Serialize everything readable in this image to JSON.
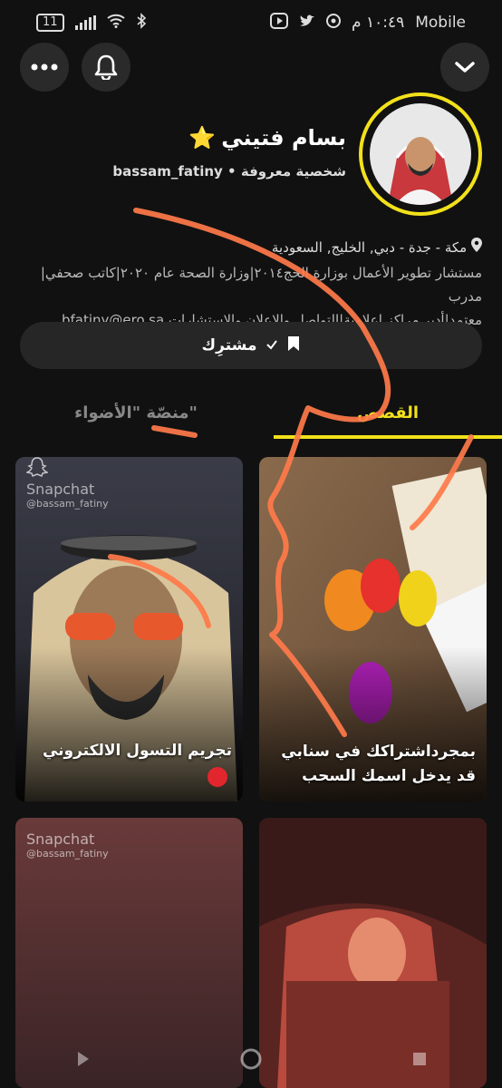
{
  "status_bar": {
    "battery": "11",
    "time": "١٠:٤٩ م",
    "carrier": "Mobile"
  },
  "profile": {
    "display_name": "بسام فتيني",
    "name_badge": "⭐",
    "username": "bassam_fatiny",
    "separator": "•",
    "category": "شخصية معروفة",
    "location": "مكة - جدة - دبي, الخليج, السعودية",
    "bio_line1": "مستشار تطوير الأعمال بوزارة الحج٢٠١٤|وزارة الصحة عام ٢٠٢٠|كاتب صحفي|مدرب",
    "bio_line2": "معتمد|أدير مراكز إعلامية|التواصل والإعلان والإستشارات bfatiny@ero.sa"
  },
  "subscribe_button": {
    "label": "مشترِك"
  },
  "tabs": [
    {
      "label": "القصص",
      "active": true
    },
    {
      "label": "منصّة \"الأضواء\"",
      "active": false
    }
  ],
  "cards": [
    {
      "caption": "بمجرداشتراكك في سنابي قد يدخل اسمك السحب",
      "watermark": ""
    },
    {
      "caption": "تجريم التسول الالكتروني",
      "watermark": "Snapchat",
      "watermark_handle": "@bassam_fatiny"
    },
    {
      "caption": "",
      "watermark": ""
    },
    {
      "caption": "",
      "watermark": "Snapchat",
      "watermark_handle": "@bassam_fatiny"
    }
  ],
  "colors": {
    "accent": "#f2e11b",
    "annotation": "#ff7a4a",
    "background": "#111111"
  }
}
